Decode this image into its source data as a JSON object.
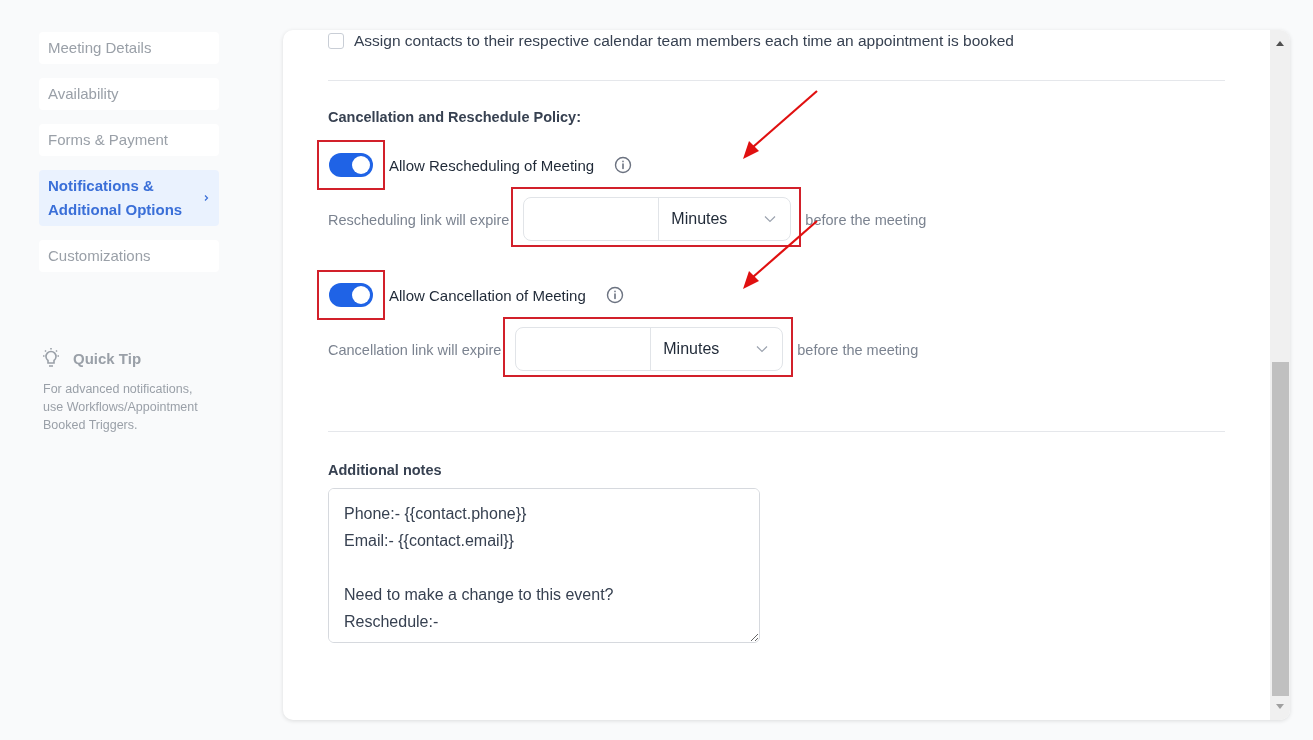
{
  "sidebar": {
    "items": [
      {
        "label": "Meeting Details",
        "selected": false
      },
      {
        "label": "Availability",
        "selected": false
      },
      {
        "label": "Forms & Payment",
        "selected": false
      },
      {
        "label": "Notifications & Additional Options",
        "selected": true
      },
      {
        "label": "Customizations",
        "selected": false
      }
    ],
    "quick_tip": {
      "title": "Quick Tip",
      "text": "For advanced notifications, use Workflows/Appointment Booked Triggers."
    }
  },
  "assign_option": {
    "label": "Assign contacts to their respective calendar team members each time an appointment is booked",
    "checked": false
  },
  "policy": {
    "heading": "Cancellation and Reschedule Policy:",
    "settings": [
      {
        "label": "Allow Rescheduling of Meeting",
        "on": true,
        "highlighted": true,
        "expiry_prefix": "Rescheduling link will expire",
        "unit": "Minutes",
        "expiry_suffix": "before the meeting",
        "expiry_highlighted": true
      },
      {
        "label": "Allow Cancellation of Meeting",
        "on": true,
        "highlighted": true,
        "expiry_prefix": "Cancellation link will expire",
        "unit": "Minutes",
        "expiry_suffix": "before the meeting",
        "expiry_highlighted": true
      }
    ]
  },
  "notes": {
    "label": "Additional notes",
    "value": "Phone:- {{contact.phone}}\nEmail:- {{contact.email}}\n\nNeed to make a change to this event?\nReschedule:-"
  }
}
